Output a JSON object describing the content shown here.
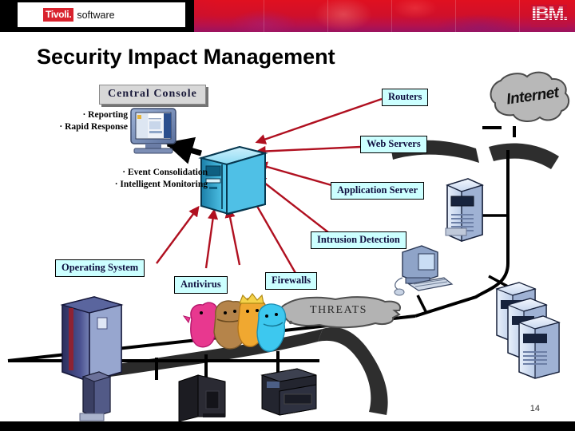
{
  "header": {
    "tivoli_mark": "Tivoli.",
    "tivoli_word": "software",
    "ibm_logo": "IBM.",
    "brand_red": "#d3102a",
    "brand_magenta": "#9b1360"
  },
  "title": "Security Impact Management",
  "page_number": "14",
  "diagram": {
    "console_label": "Central Console",
    "console_bullets": "· Reporting\n· Rapid Response",
    "console_bullet_items": [
      "Reporting",
      "Rapid Response"
    ],
    "server_bullets": "· Event Consolidation\n· Intelligent Monitoring",
    "server_bullet_items": [
      "Event Consolidation",
      "Intelligent Monitoring"
    ],
    "internet_label": "Internet",
    "threats_label": "THREATS",
    "nodes": [
      {
        "id": "routers",
        "label": "Routers"
      },
      {
        "id": "web-servers",
        "label": "Web Servers"
      },
      {
        "id": "application-server",
        "label": "Application Server"
      },
      {
        "id": "intrusion-detection",
        "label": "Intrusion Detection"
      },
      {
        "id": "operating-system",
        "label": "Operating System"
      },
      {
        "id": "antivirus",
        "label": "Antivirus"
      },
      {
        "id": "firewalls",
        "label": "Firewalls"
      }
    ],
    "colors": {
      "label_fill": "#ccffff",
      "label_border": "#000000",
      "arrow_red": "#b01020",
      "cloud_gray": "#b3b3b3",
      "network_black": "#000000",
      "console_fill": "#d8d8d8"
    }
  }
}
